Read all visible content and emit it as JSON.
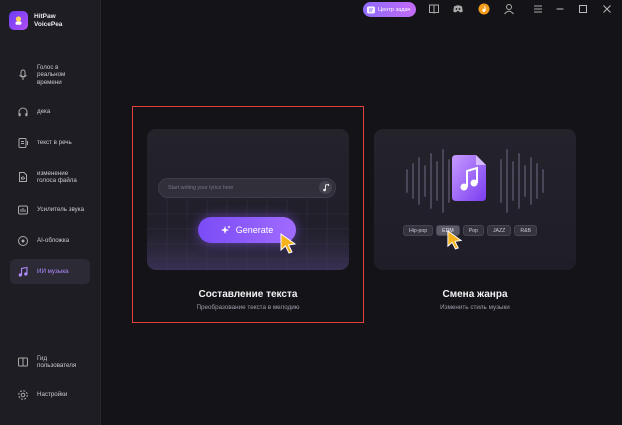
{
  "app": {
    "name": "HitPaw VoicePea"
  },
  "sidebar": {
    "items": [
      {
        "label": "Голос в реальном времени",
        "icon": "microphone-icon"
      },
      {
        "label": "дека",
        "icon": "headphones-icon"
      },
      {
        "label": "текст в речь",
        "icon": "text-to-speech-icon"
      },
      {
        "label": "изменение голоса файла",
        "icon": "file-voice-icon"
      },
      {
        "label": "Усилитель звука",
        "icon": "sound-enhancer-icon"
      },
      {
        "label": "AI-обложка",
        "icon": "ai-cover-icon"
      },
      {
        "label": "ИИ музыка",
        "icon": "ai-music-icon",
        "active": true
      }
    ],
    "bottom": [
      {
        "label": "Гид пользователя",
        "icon": "guide-icon"
      },
      {
        "label": "Настройки",
        "icon": "settings-icon"
      }
    ]
  },
  "topbar": {
    "task_center_label": "Центр задач",
    "icons": [
      "book-icon",
      "discord-icon",
      "fire-icon",
      "user-icon",
      "menu-icon",
      "minimize-icon",
      "maximize-icon",
      "close-icon"
    ]
  },
  "cards": {
    "lyrics": {
      "title": "Составление текста",
      "subtitle": "Преобразование текста в мелодию",
      "input_placeholder": "Start writing your lyrics here",
      "generate_label": "Generate"
    },
    "genre": {
      "title": "Смена жанра",
      "subtitle": "Изменить стиль музыки",
      "genres": [
        "Hip-pop",
        "EDM",
        "Pop",
        "JAZZ",
        "R&B"
      ],
      "selected_genre": "EDM"
    }
  },
  "colors": {
    "accent": "#8f5cff",
    "highlight_border": "#e0403e",
    "cursor": "#f5b21c"
  }
}
